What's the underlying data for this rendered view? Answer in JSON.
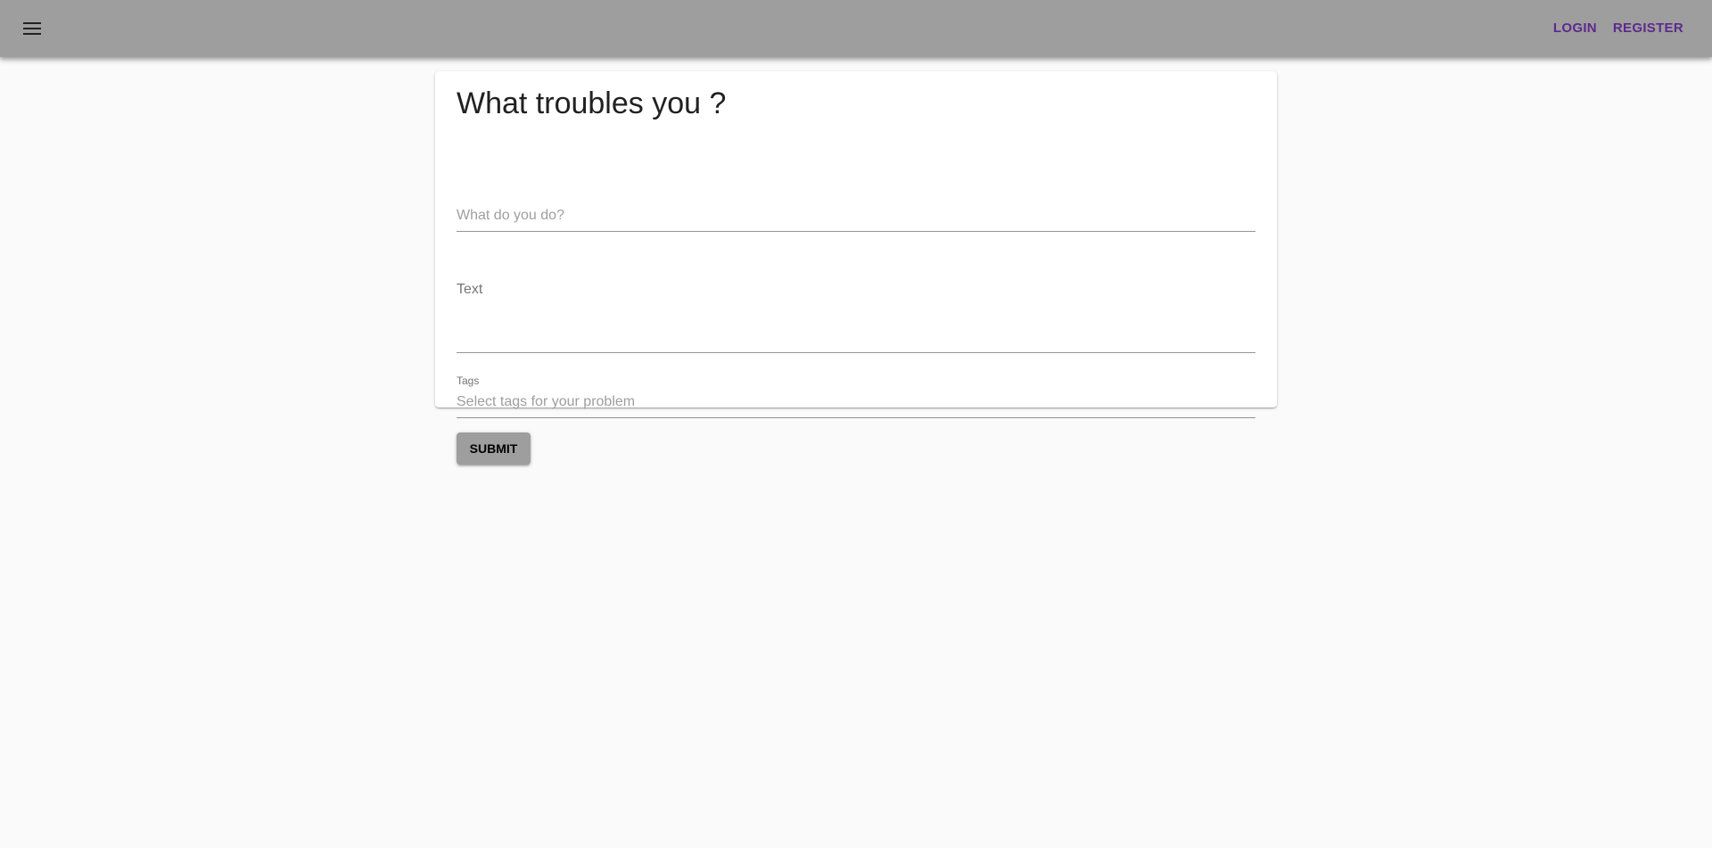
{
  "appbar": {
    "menu_icon": "menu-icon",
    "login_label": "LOGIN",
    "register_label": "REGISTER",
    "background_color": "#9e9e9e",
    "link_color": "#5c2a8c"
  },
  "form": {
    "title": "What troubles you ?",
    "role_field": {
      "placeholder": "What do you do?",
      "value": ""
    },
    "text_field": {
      "label": "Text",
      "value": ""
    },
    "tags_field": {
      "label": "Tags",
      "placeholder": "Select tags for your problem",
      "value": ""
    },
    "submit_label": "SUBMIT"
  }
}
